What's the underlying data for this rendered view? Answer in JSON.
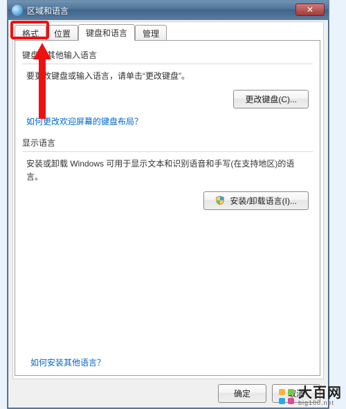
{
  "window": {
    "title": "区域和语言",
    "close_glyph": "✕"
  },
  "tabs": [
    {
      "label": "格式"
    },
    {
      "label": "位置"
    },
    {
      "label": "键盘和语言"
    },
    {
      "label": "管理"
    }
  ],
  "group_keyboards": {
    "title": "键盘和其他输入语言",
    "desc": "要更改键盘或输入语言，请单击“更改键盘”。",
    "change_button": "更改键盘(C)...",
    "welcome_link": "如何更改欢迎屏幕的键盘布局？"
  },
  "group_display": {
    "title": "显示语言",
    "desc": "安装或卸载 Windows 可用于显示文本和识别语音和手写(在支持地区)的语言。",
    "install_button": "安装/卸载语言(I)..."
  },
  "help_link": "如何安装其他语言？",
  "dialog_buttons": {
    "ok": "确定",
    "cancel": "取消"
  },
  "watermark": {
    "name": "大百网",
    "url": "big100.net"
  }
}
